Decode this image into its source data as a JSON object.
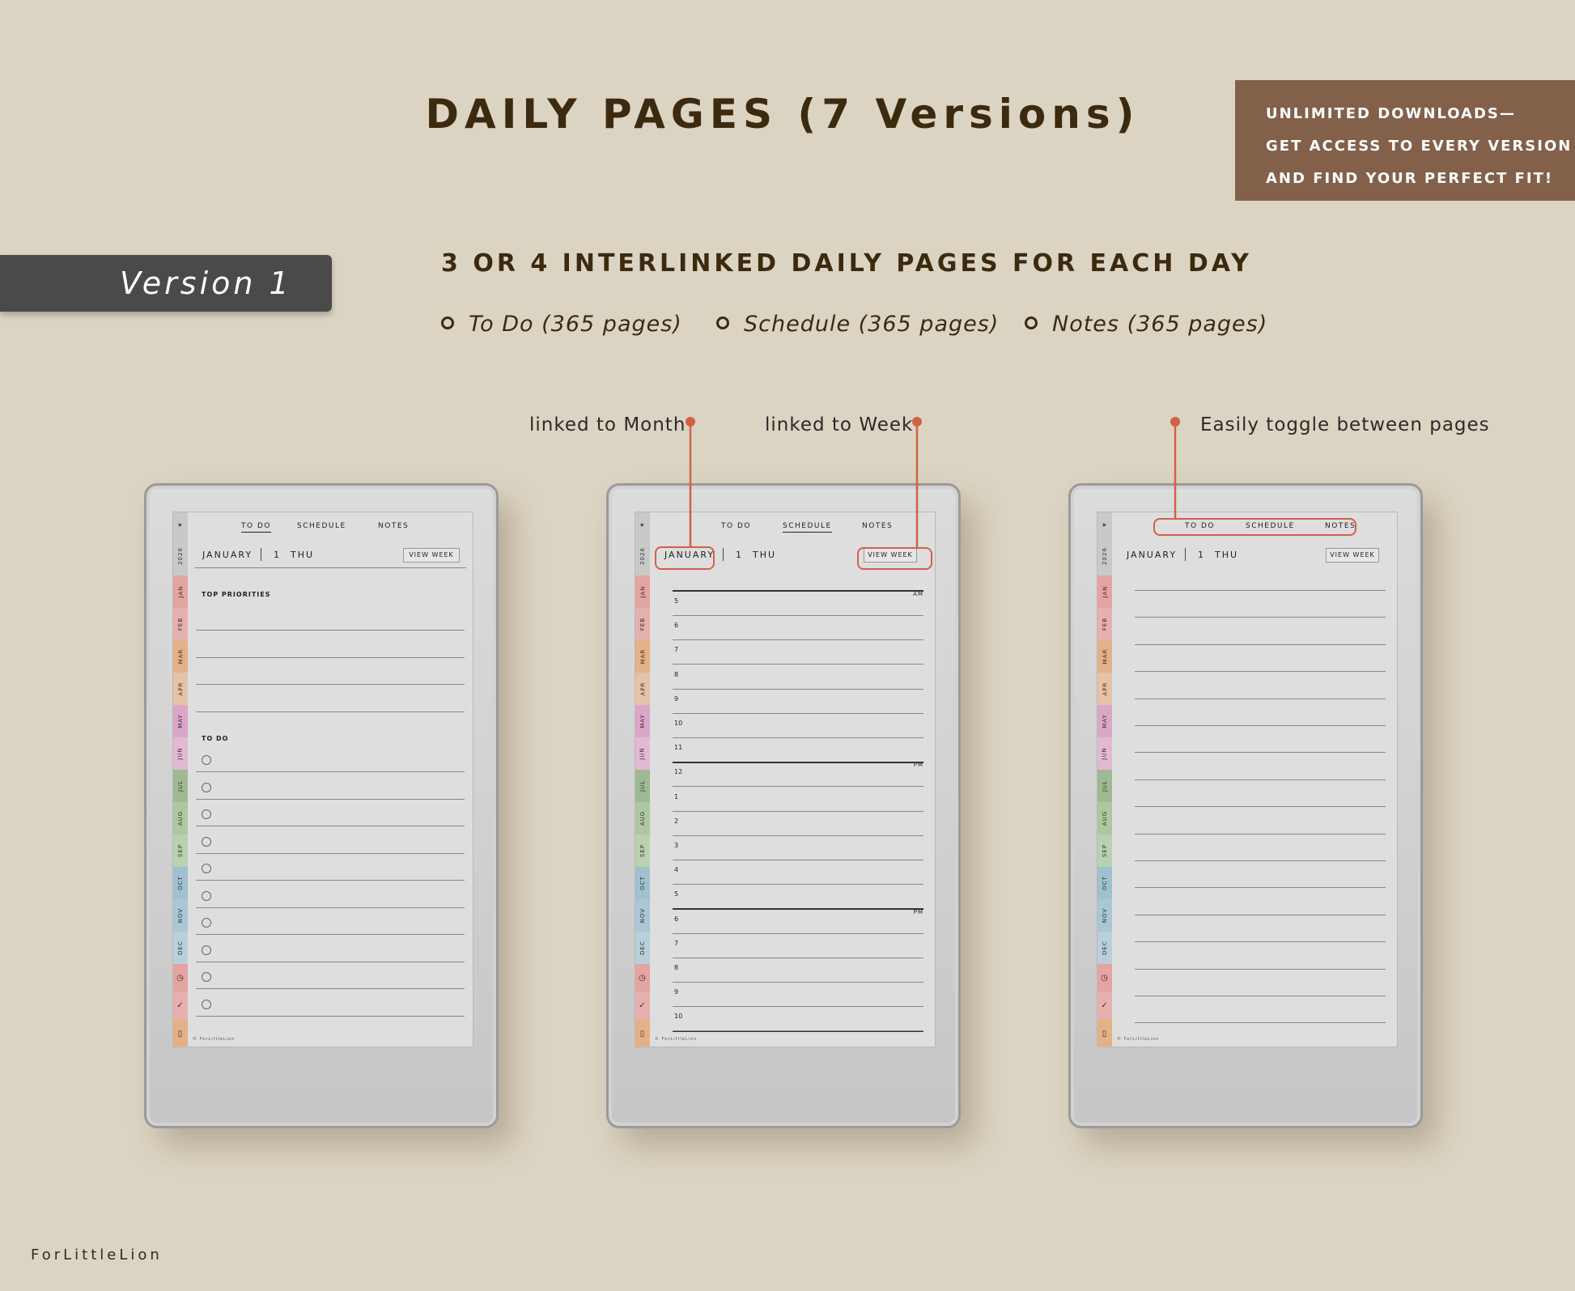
{
  "title": "DAILY PAGES (7 Versions)",
  "promo": {
    "line1": "UNLIMITED DOWNLOADS—",
    "line2": "GET ACCESS TO EVERY VERSION",
    "line3": "AND FIND YOUR PERFECT FIT!"
  },
  "version_label": "Version 1",
  "subtitle": "3 OR 4 INTERLINKED DAILY PAGES FOR EACH DAY",
  "bullets": [
    "To Do (365 pages)",
    "Schedule (365 pages)",
    "Notes (365 pages)"
  ],
  "callouts": {
    "month": "linked to Month",
    "week": "linked to Week",
    "toggle": "Easily toggle between pages"
  },
  "accent_color": "#d0624a",
  "nav": {
    "todo": "TO DO",
    "schedule": "SCHEDULE",
    "notes": "NOTES"
  },
  "header": {
    "month": "JANUARY",
    "day": "1",
    "weekday": "THU",
    "view_week": "VIEW WEEK"
  },
  "sidebar_tabs": [
    {
      "label": "★",
      "color": "#c9c9c9"
    },
    {
      "label": "2026",
      "color": "#c9c9c9"
    },
    {
      "label": "JAN",
      "color": "#e4a4a1"
    },
    {
      "label": "FEB",
      "color": "#e6b0ae"
    },
    {
      "label": "MAR",
      "color": "#e4b186"
    },
    {
      "label": "APR",
      "color": "#e6c2a6"
    },
    {
      "label": "MAY",
      "color": "#dca6c9"
    },
    {
      "label": "JUN",
      "color": "#e3b8d2"
    },
    {
      "label": "JUL",
      "color": "#9fba92"
    },
    {
      "label": "AUG",
      "color": "#aec7a1"
    },
    {
      "label": "SEP",
      "color": "#b9d1ae"
    },
    {
      "label": "OCT",
      "color": "#9fc0cf"
    },
    {
      "label": "NOV",
      "color": "#a9c7d4"
    },
    {
      "label": "DEC",
      "color": "#b8d0da"
    },
    {
      "label": "clock-icon",
      "color": "#e4a4a1"
    },
    {
      "label": "check-icon",
      "color": "#e6b0ae"
    },
    {
      "label": "note-icon",
      "color": "#e4b186"
    }
  ],
  "todo_page": {
    "priorities_label": "TOP PRIORITIES",
    "todo_label": "TO DO"
  },
  "schedule_page": {
    "hours": [
      "5",
      "6",
      "7",
      "8",
      "9",
      "10",
      "11",
      "12",
      "1",
      "2",
      "3",
      "4",
      "5",
      "6",
      "7",
      "8",
      "9",
      "10"
    ],
    "am": "AM",
    "pm1": "PM",
    "pm2": "PM"
  },
  "copyright": "© ForLittleLion",
  "brand": "ForLittleLion"
}
